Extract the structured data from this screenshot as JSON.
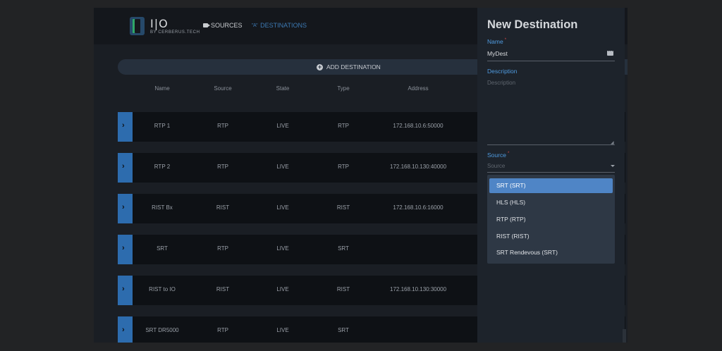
{
  "brand": {
    "name": "I|O",
    "tagline": "BY CERBERUS.TECH"
  },
  "nav": {
    "sources_label": "SOURCES",
    "destinations_label": "DESTINATIONS",
    "destinations_icon_text": "\"A\""
  },
  "toolbar": {
    "add_destination_label": "ADD DESTINATION"
  },
  "table": {
    "headers": [
      "Name",
      "Source",
      "State",
      "Type",
      "Address"
    ],
    "rows": [
      {
        "name": "RTP 1",
        "source": "RTP",
        "state": "LIVE",
        "type": "RTP",
        "address": "172.168.10.6:50000"
      },
      {
        "name": "RTP 2",
        "source": "RTP",
        "state": "LIVE",
        "type": "RTP",
        "address": "172.168.10.130:40000"
      },
      {
        "name": "RIST Bx",
        "source": "RIST",
        "state": "LIVE",
        "type": "RIST",
        "address": "172.168.10.6:16000"
      },
      {
        "name": "SRT",
        "source": "RTP",
        "state": "LIVE",
        "type": "SRT",
        "address": ""
      },
      {
        "name": "RIST to IO",
        "source": "RIST",
        "state": "LIVE",
        "type": "RIST",
        "address": "172.168.10.130:30000"
      },
      {
        "name": "SRT DR5000",
        "source": "RTP",
        "state": "LIVE",
        "type": "SRT",
        "address": ""
      }
    ]
  },
  "panel": {
    "title": "New Destination",
    "name_label": "Name",
    "name_value": "MyDest",
    "description_label": "Description",
    "description_placeholder": "Description",
    "source_label": "Source",
    "source_placeholder": "Source",
    "required_marker": "*",
    "source_options": [
      {
        "label": "SRT (SRT)",
        "selected": true
      },
      {
        "label": "HLS (HLS)",
        "selected": false
      },
      {
        "label": "RTP (RTP)",
        "selected": false
      },
      {
        "label": "RIST (RIST)",
        "selected": false
      },
      {
        "label": "SRT Rendevous (SRT)",
        "selected": false
      }
    ]
  },
  "colors": {
    "accent": "#2d6cae",
    "nav_active": "#3c79b3",
    "label_blue": "#4f9be0",
    "selected_option": "#4f85c6"
  },
  "icons": {
    "sources": "camera-icon",
    "destinations": "destination-icon",
    "add": "plus-circle-icon",
    "expand": "chevron-right-icon",
    "name_field_menu": "more-icon",
    "source_select": "caret-down-icon"
  }
}
